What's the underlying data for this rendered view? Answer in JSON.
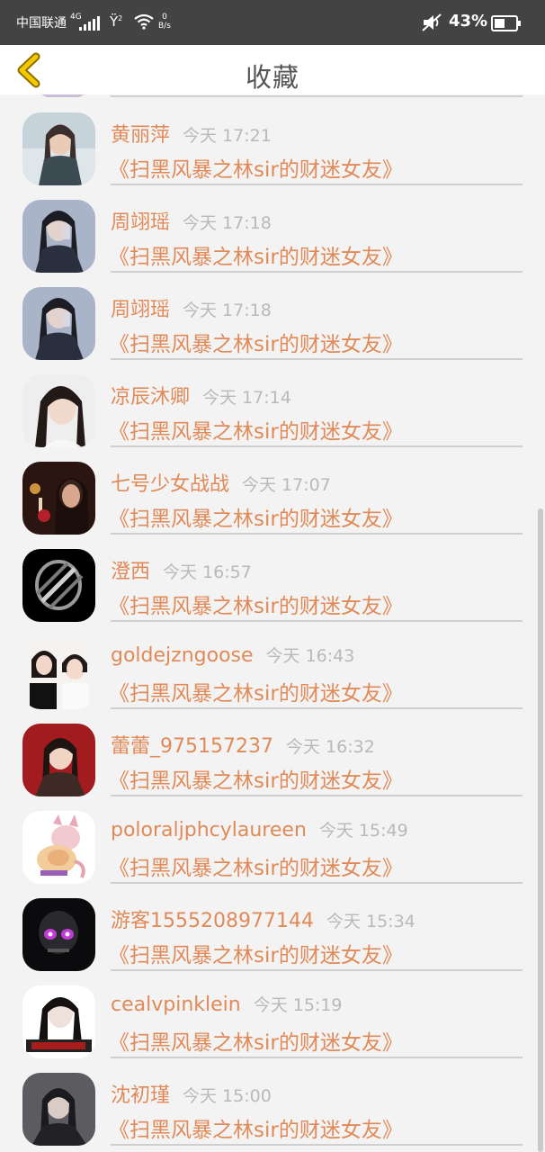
{
  "status_bar": {
    "carrier": "中国联通",
    "network": "4G",
    "sim2": "2",
    "speed": "0",
    "speed_unit": "B/s",
    "battery": "43%"
  },
  "header": {
    "title": "收藏",
    "back_icon": "chevron-left-icon",
    "accent": "#f2c400"
  },
  "colors": {
    "name": "#e08a58",
    "title": "#e08a58",
    "time": "#b9b9b9",
    "divider": "#cfcfcf"
  },
  "items": [
    {
      "name": "黄丽萍",
      "time": "今天 17:21",
      "title": "《扫黑风暴之林sir的财迷女友》"
    },
    {
      "name": "周翊瑶",
      "time": "今天 17:18",
      "title": "《扫黑风暴之林sir的财迷女友》"
    },
    {
      "name": "周翊瑶",
      "time": "今天 17:18",
      "title": "《扫黑风暴之林sir的财迷女友》"
    },
    {
      "name": "凉辰沐卿",
      "time": "今天 17:14",
      "title": "《扫黑风暴之林sir的财迷女友》"
    },
    {
      "name": "七号少女战战",
      "time": "今天 17:07",
      "title": "《扫黑风暴之林sir的财迷女友》"
    },
    {
      "name": "澄西",
      "time": "今天 16:57",
      "title": "《扫黑风暴之林sir的财迷女友》"
    },
    {
      "name": "goldejzngoose",
      "time": "今天 16:43",
      "title": "《扫黑风暴之林sir的财迷女友》"
    },
    {
      "name": "蕾蕾_975157237",
      "time": "今天 16:32",
      "title": "《扫黑风暴之林sir的财迷女友》"
    },
    {
      "name": "poloraljphcylaureen",
      "time": "今天 15:49",
      "title": "《扫黑风暴之林sir的财迷女友》"
    },
    {
      "name": "游客1555208977144",
      "time": "今天 15:34",
      "title": "《扫黑风暴之林sir的财迷女友》"
    },
    {
      "name": "cealvpinklein",
      "time": "今天 15:19",
      "title": "《扫黑风暴之林sir的财迷女友》"
    },
    {
      "name": "沈初瑾",
      "time": "今天 15:00",
      "title": "《扫黑风暴之林sir的财迷女友》"
    }
  ]
}
